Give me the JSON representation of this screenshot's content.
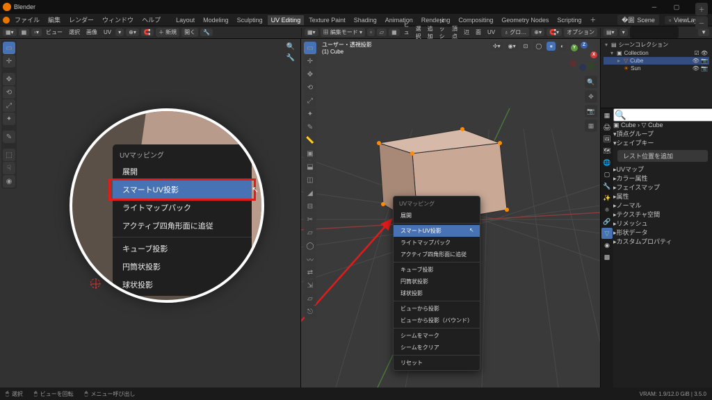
{
  "app": {
    "title": "Blender"
  },
  "topmenu": {
    "items": [
      "ファイル",
      "編集",
      "レンダー",
      "ウィンドウ",
      "ヘルプ"
    ],
    "workspaces": [
      "Layout",
      "Modeling",
      "Sculpting",
      "UV Editing",
      "Texture Paint",
      "Shading",
      "Animation",
      "Rendering",
      "Compositing",
      "Geometry Nodes",
      "Scripting"
    ],
    "active_workspace": "UV Editing",
    "scene_label": "Scene",
    "viewlayer_label": "ViewLayer"
  },
  "uvbar": {
    "items": [
      "ビュー",
      "選択",
      "画像",
      "UV"
    ],
    "new": "＋ 新規",
    "open": "開く"
  },
  "vpbar": {
    "mode": "編集モード",
    "items": [
      "ビュー",
      "選択",
      "追加",
      "メッシュ",
      "頂点",
      "辺",
      "面",
      "UV"
    ],
    "global": "グロ…",
    "options": "オプション"
  },
  "vpheader": {
    "l1": "ユーザー・透視投影",
    "l2": "(1) Cube"
  },
  "outliner": {
    "header": "シーンコレクション",
    "rows": [
      {
        "icon": "▾",
        "label": "Collection",
        "sel": false
      },
      {
        "icon": "▾",
        "label": "Cube",
        "sel": true,
        "obj": "mesh"
      },
      {
        "icon": "",
        "label": "Sun",
        "sel": false,
        "obj": "light"
      }
    ]
  },
  "props": {
    "search_ph": "",
    "crumb1": "Cube",
    "crumb2": "Cube",
    "panels": [
      "頂点グループ",
      "シェイプキー",
      "UVマップ",
      "カラー属性",
      "フェイスマップ",
      "属性",
      "ノーマル",
      "テクスチャ空間",
      "リメッシュ",
      "形状データ",
      "カスタムプロパティ"
    ],
    "rest_pos": "レスト位置を追加"
  },
  "ctx": {
    "title": "UVマッピング",
    "items": [
      "展開",
      "スマートUV投影",
      "ライトマップパック",
      "アクティブ四角形面に追従",
      "キューブ投影",
      "円筒状投影",
      "球状投影",
      "ビューから投影",
      "ビューから投影（バウンド）",
      "シームをマーク",
      "シームをクリア",
      "リセット"
    ],
    "groups": [
      [
        0
      ],
      [
        1,
        2,
        3
      ],
      [
        4,
        5,
        6
      ],
      [
        7,
        8
      ],
      [
        9,
        10
      ],
      [
        11
      ]
    ],
    "highlight": 1
  },
  "zoom": {
    "title": "UVマッピング",
    "items": [
      "展開",
      "スマートUV投影",
      "ライトマップパック",
      "アクティブ四角形面に追従",
      "キューブ投影",
      "円筒状投影",
      "球状投影"
    ],
    "highlight": 1
  },
  "status": {
    "items": [
      "選択",
      "ビューを回転",
      "メニュー呼び出し"
    ],
    "vram": "VRAM: 1.9/12.0 GiB | 3.5.0"
  },
  "colors": {
    "accent": "#4772b3",
    "red": "#e21b1b",
    "orange": "#ea7600"
  }
}
